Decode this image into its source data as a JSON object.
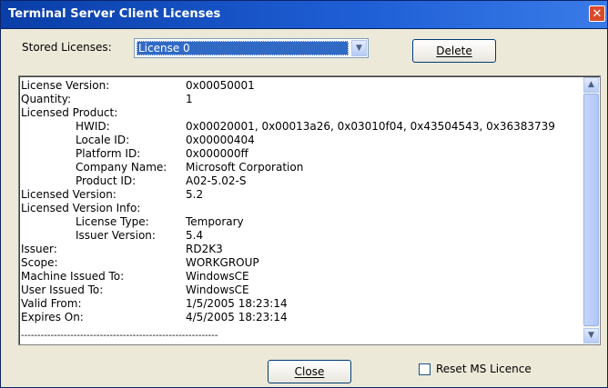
{
  "window": {
    "title": "Terminal Server Client Licenses",
    "close_glyph": "✕"
  },
  "stored": {
    "label": "Stored Licenses:",
    "selected": "License 0",
    "delete_label": "Delete"
  },
  "details": [
    {
      "key": "License Version:",
      "value": "0x00050001",
      "indent": false
    },
    {
      "key": "Quantity:",
      "value": "1",
      "indent": false
    },
    {
      "key": "Licensed Product:",
      "value": "",
      "indent": false
    },
    {
      "key": "HWID:",
      "value": "0x00020001, 0x00013a26, 0x03010f04, 0x43504543, 0x36383739",
      "indent": true
    },
    {
      "key": "Locale ID:",
      "value": "0x00000404",
      "indent": true
    },
    {
      "key": "Platform ID:",
      "value": "0x000000ff",
      "indent": true
    },
    {
      "key": "Company Name:",
      "value": "Microsoft Corporation",
      "indent": true
    },
    {
      "key": "Product ID:",
      "value": "A02-5.02-S",
      "indent": true
    },
    {
      "key": "Licensed Version:",
      "value": "5.2",
      "indent": false
    },
    {
      "key": "Licensed Version Info:",
      "value": "",
      "indent": false
    },
    {
      "key": "License Type:",
      "value": "Temporary",
      "indent": true
    },
    {
      "key": "Issuer Version:",
      "value": "5.4",
      "indent": true
    },
    {
      "key": "Issuer:",
      "value": "RD2K3",
      "indent": false
    },
    {
      "key": "Scope:",
      "value": "WORKGROUP",
      "indent": false
    },
    {
      "key": "Machine Issued To:",
      "value": "WindowsCE",
      "indent": false
    },
    {
      "key": "User Issued To:",
      "value": "WindowsCE",
      "indent": false
    },
    {
      "key": "Valid From:",
      "value": "1/5/2005 18:23:14",
      "indent": false
    },
    {
      "key": "Expires On:",
      "value": "4/5/2005 18:23:14",
      "indent": false
    }
  ],
  "separator": "------------------------------------------------------------",
  "footer": {
    "close_label": "Close",
    "reset_label": "Reset MS Licence",
    "reset_checked": false
  }
}
